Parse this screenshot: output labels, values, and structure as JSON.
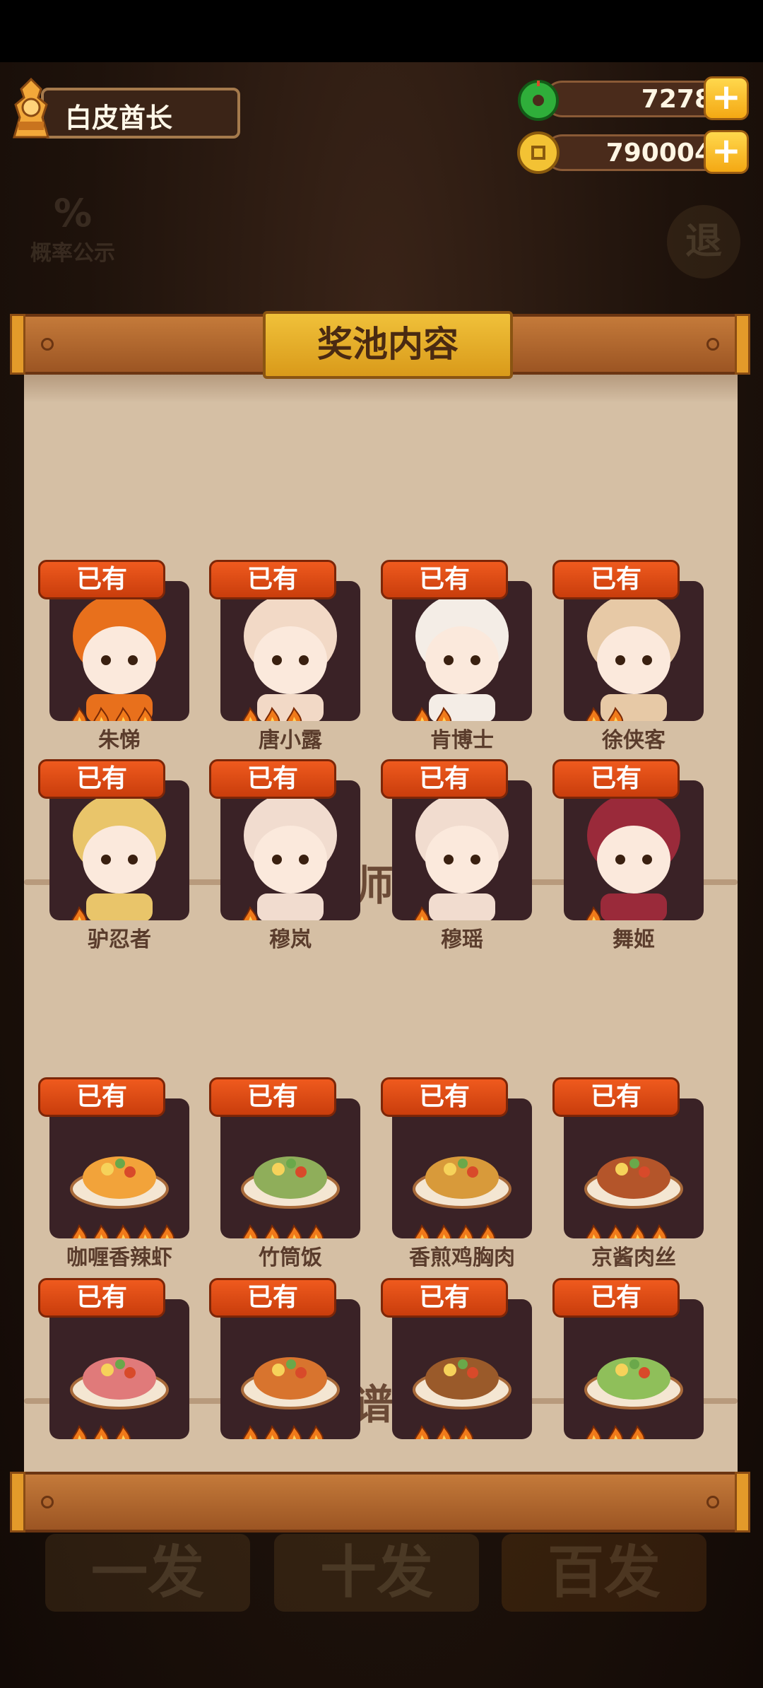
{
  "player": {
    "name": "白皮酋长"
  },
  "currency": {
    "jade": "7278",
    "gold": "790004",
    "plus": "+"
  },
  "background": {
    "prob_label": "概率公示",
    "exit_label": "退",
    "pull_one": "一发",
    "pull_ten": "十发",
    "pull_hundred": "百发"
  },
  "modal": {
    "title": "奖池内容",
    "chef_section": "厨师",
    "recipe_section": "菜谱",
    "help": "?",
    "owned_label": "已有",
    "chefs": [
      {
        "name": "朱悌",
        "stars": 4
      },
      {
        "name": "唐小露",
        "stars": 3
      },
      {
        "name": "肯博士",
        "stars": 2
      },
      {
        "name": "徐侠客",
        "stars": 2
      },
      {
        "name": "驴忍者",
        "stars": 1
      },
      {
        "name": "穆岚",
        "stars": 1
      },
      {
        "name": "穆瑶",
        "stars": 1
      },
      {
        "name": "舞姬",
        "stars": 1
      }
    ],
    "recipes": [
      {
        "name": "咖喱香辣虾",
        "stars": 5
      },
      {
        "name": "竹筒饭",
        "stars": 4
      },
      {
        "name": "香煎鸡胸肉",
        "stars": 4
      },
      {
        "name": "京酱肉丝",
        "stars": 4
      },
      {
        "name": "",
        "stars": 3
      },
      {
        "name": "",
        "stars": 4
      },
      {
        "name": "",
        "stars": 3
      },
      {
        "name": "",
        "stars": 3
      }
    ]
  },
  "colors": {
    "owned_tag": "#e04a14",
    "card_bg": "#3a2226",
    "paper": "#d5bfa4",
    "title_gold": "#e8b12c"
  }
}
